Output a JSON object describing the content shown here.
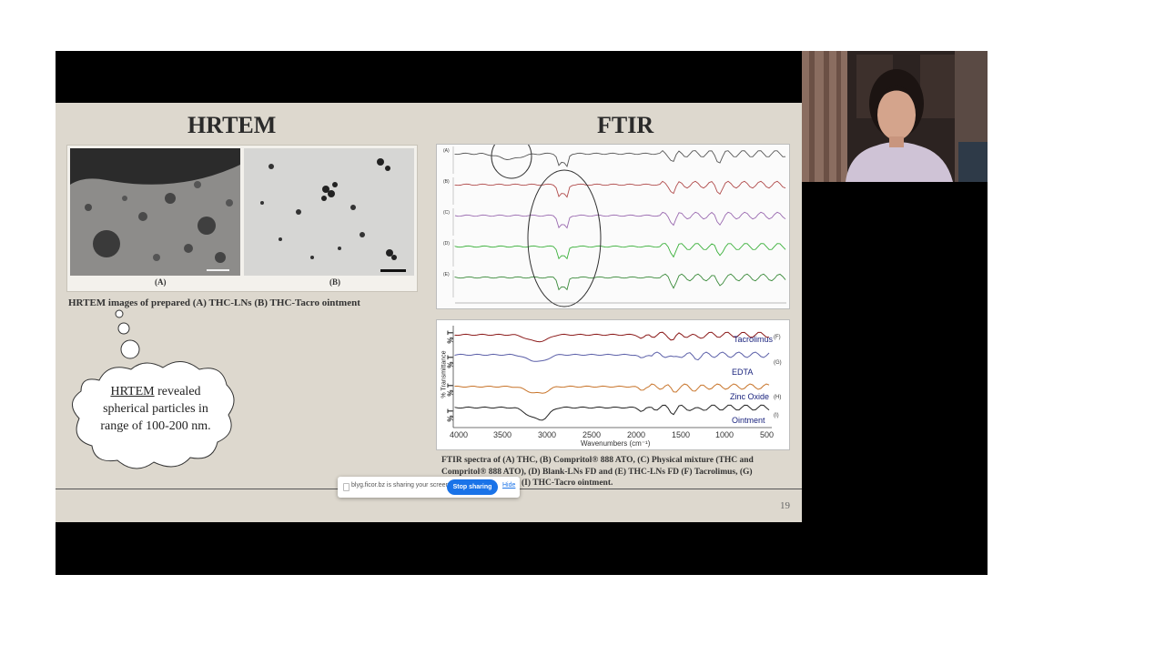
{
  "slide": {
    "hrtem_title": "HRTEM",
    "ftir_title": "FTIR",
    "image_label_a": "(A)",
    "image_label_b": "(B)",
    "hrtem_caption": "HRTEM images of prepared (A) THC-LNs (B) THC-Tacro ointment",
    "cloud_head": "HRTEM",
    "cloud_rest": " revealed spherical particles in range of  100-200 nm.",
    "ftir_caption_1": "FTIR spectra of (A) THC, (B) Compritol® 888 ATO, (C) Physical mixture (THC and",
    "ftir_caption_2": "Compritol® 888 ATO), (D) Blank-LNs FD and (E) THC-LNs FD (F) Tacrolimus, (G)",
    "ftir_caption_3": "(I) THC-Tacro ointment.",
    "page_number": "19"
  },
  "ftir_lower": {
    "y_label": "% Transmittance",
    "x_label": "Wavenumbers (cm⁻¹)",
    "x_ticks": [
      "4000",
      "3500",
      "3000",
      "2500",
      "2000",
      "1500",
      "1000",
      "500"
    ],
    "pct_t": "% T",
    "traces": [
      {
        "name": "Tacrolimus",
        "tag": "(F)",
        "color": "#8b1a1a"
      },
      {
        "name": "EDTA",
        "tag": "(G)",
        "color": "#5b5fa8"
      },
      {
        "name": "Zinc Oxide",
        "tag": "(H)",
        "color": "#c8742a"
      },
      {
        "name": "Ointment",
        "tag": "(I)",
        "color": "#222222"
      }
    ]
  },
  "ftir_upper": {
    "trace_tags": [
      "(A)",
      "(B)",
      "(C)",
      "(D)",
      "(E)"
    ],
    "trace_colors": [
      "#555555",
      "#b04a4a",
      "#9a6ab0",
      "#3ab03a",
      "#3a8a3a"
    ]
  },
  "share_bar": {
    "message": "blyg.ficor.bz is sharing your screen.",
    "stop_label": "Stop sharing",
    "hide_label": "Hide"
  }
}
